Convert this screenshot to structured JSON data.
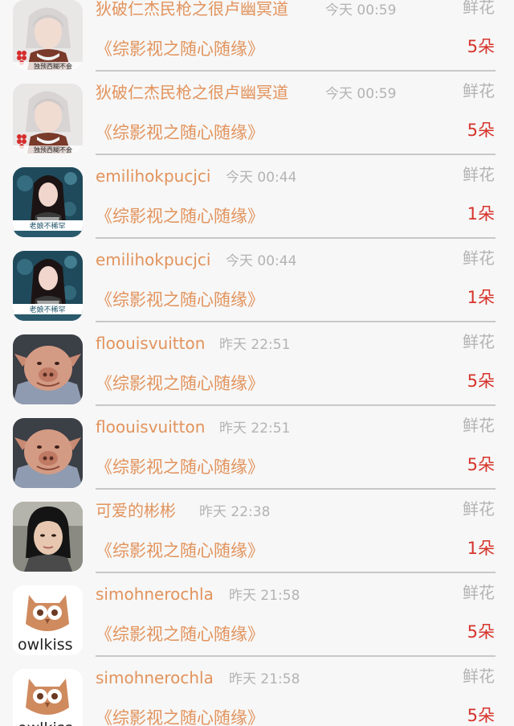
{
  "gift_label": "鲜花",
  "entries": [
    {
      "avatar": "bubble-hat-girl",
      "avatar_caption": "独预西糊不会",
      "user": "狄破仁杰民枪之很卢幽冥道",
      "time": "今天 00:59",
      "book": "《综影视之随心随缘》",
      "count": "5朵"
    },
    {
      "avatar": "bubble-hat-girl",
      "avatar_caption": "独预西糊不会",
      "user": "狄破仁杰民枪之很卢幽冥道",
      "time": "今天 00:59",
      "book": "《综影视之随心随缘》",
      "count": "5朵"
    },
    {
      "avatar": "long-hair-girl",
      "avatar_caption": "老娘不稀罕",
      "user": "emilihokpucjci",
      "time": "今天 00:44",
      "book": "《综影视之随心随缘》",
      "count": "1朵"
    },
    {
      "avatar": "long-hair-girl",
      "avatar_caption": "老娘不稀罕",
      "user": "emilihokpucjci",
      "time": "今天 00:44",
      "book": "《综影视之随心随缘》",
      "count": "1朵"
    },
    {
      "avatar": "pig-man",
      "avatar_caption": "",
      "user": "floouisvuitton",
      "time": "昨天 22:51",
      "book": "《综影视之随心随缘》",
      "count": "5朵"
    },
    {
      "avatar": "pig-man",
      "avatar_caption": "",
      "user": "floouisvuitton",
      "time": "昨天 22:51",
      "book": "《综影视之随心随缘》",
      "count": "5朵"
    },
    {
      "avatar": "selfie-girl",
      "avatar_caption": "",
      "user": "可爱的彬彬",
      "time": "昨天 22:38",
      "book": "《综影视之随心随缘》",
      "count": "1朵"
    },
    {
      "avatar": "owl-logo",
      "avatar_caption": "owlkiss",
      "user": "simohnerochla",
      "time": "昨天 21:58",
      "book": "《综影视之随心随缘》",
      "count": "5朵"
    },
    {
      "avatar": "owl-logo",
      "avatar_caption": "owlkiss",
      "user": "simohnerochla",
      "time": "昨天 21:58",
      "book": "《综影视之随心随缘》",
      "count": "5朵"
    }
  ]
}
